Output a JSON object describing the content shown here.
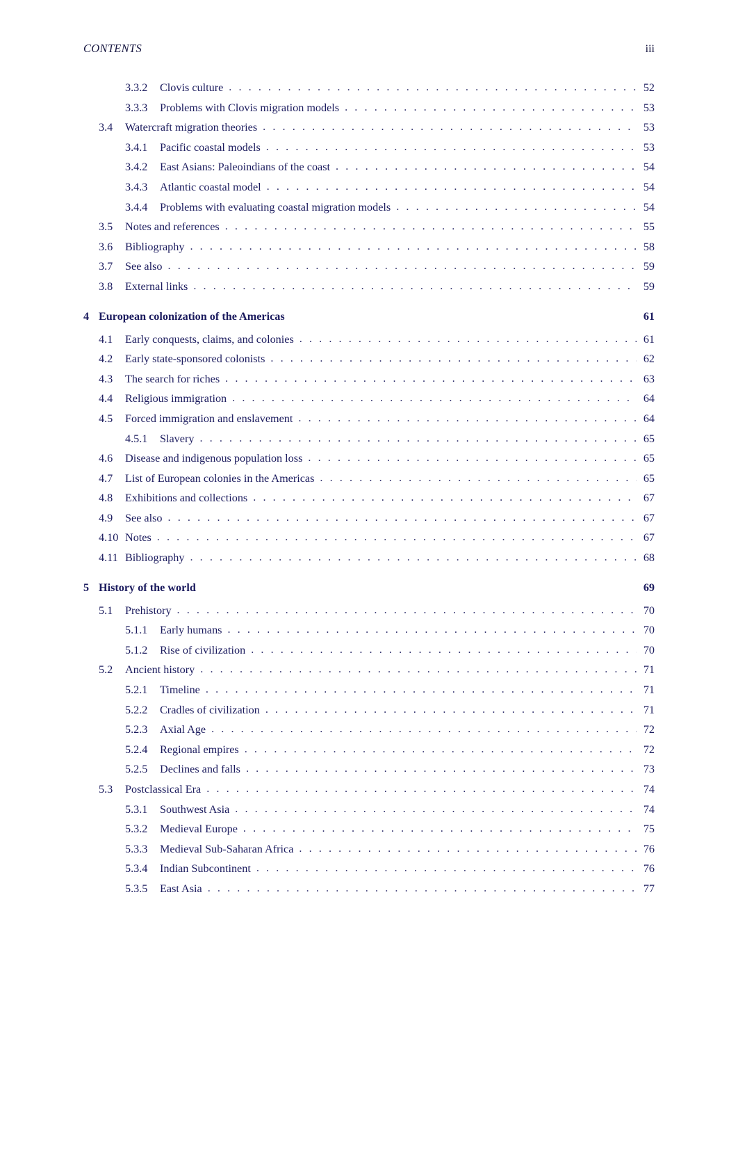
{
  "header": {
    "title": "CONTENTS",
    "folio": "iii"
  },
  "colors": {
    "text": "#1b1b5e",
    "page_background": "#ffffff"
  },
  "leader_dots": ". . . . . . . . . . . . . . . . . . . . . . . . . . . . . . . . . . . . . . . . . . . . . . . . . . . . . . . . . . . . . . . . . . . . . . . . . . . .",
  "toc": {
    "entries": [
      {
        "level": "lvl2",
        "number": "3.3.2",
        "title": "Clovis culture",
        "page": "52"
      },
      {
        "level": "lvl2",
        "number": "3.3.3",
        "title": "Problems with Clovis migration models",
        "page": "53"
      },
      {
        "level": "lvl1",
        "number": "3.4",
        "title": "Watercraft migration theories",
        "page": "53"
      },
      {
        "level": "lvl2",
        "number": "3.4.1",
        "title": "Pacific coastal models",
        "page": "53"
      },
      {
        "level": "lvl2",
        "number": "3.4.2",
        "title": "East Asians: Paleoindians of the coast",
        "page": "54"
      },
      {
        "level": "lvl2",
        "number": "3.4.3",
        "title": "Atlantic coastal model",
        "page": "54"
      },
      {
        "level": "lvl2",
        "number": "3.4.4",
        "title": "Problems with evaluating coastal migration models",
        "page": "54"
      },
      {
        "level": "lvl1",
        "number": "3.5",
        "title": "Notes and references",
        "page": "55"
      },
      {
        "level": "lvl1",
        "number": "3.6",
        "title": "Bibliography",
        "page": "58"
      },
      {
        "level": "lvl1",
        "number": "3.7",
        "title": "See also",
        "page": "59"
      },
      {
        "level": "lvl1",
        "number": "3.8",
        "title": "External links",
        "page": "59"
      },
      {
        "level": "chapter",
        "number": "4",
        "title": "European colonization of the Americas",
        "page": "61"
      },
      {
        "level": "lvl1",
        "number": "4.1",
        "title": "Early conquests, claims, and colonies",
        "page": "61"
      },
      {
        "level": "lvl1",
        "number": "4.2",
        "title": "Early state-sponsored colonists",
        "page": "62"
      },
      {
        "level": "lvl1",
        "number": "4.3",
        "title": "The search for riches",
        "page": "63"
      },
      {
        "level": "lvl1",
        "number": "4.4",
        "title": "Religious immigration",
        "page": "64"
      },
      {
        "level": "lvl1",
        "number": "4.5",
        "title": "Forced immigration and enslavement",
        "page": "64"
      },
      {
        "level": "lvl2",
        "number": "4.5.1",
        "title": "Slavery",
        "page": "65"
      },
      {
        "level": "lvl1",
        "number": "4.6",
        "title": "Disease and indigenous population loss",
        "page": "65"
      },
      {
        "level": "lvl1",
        "number": "4.7",
        "title": "List of European colonies in the Americas",
        "page": "65"
      },
      {
        "level": "lvl1",
        "number": "4.8",
        "title": "Exhibitions and collections",
        "page": "67"
      },
      {
        "level": "lvl1",
        "number": "4.9",
        "title": "See also",
        "page": "67"
      },
      {
        "level": "lvl1",
        "number": "4.10",
        "title": "Notes",
        "page": "67"
      },
      {
        "level": "lvl1",
        "number": "4.11",
        "title": "Bibliography",
        "page": "68"
      },
      {
        "level": "chapter",
        "number": "5",
        "title": "History of the world",
        "page": "69"
      },
      {
        "level": "lvl1",
        "number": "5.1",
        "title": "Prehistory",
        "page": "70"
      },
      {
        "level": "lvl2",
        "number": "5.1.1",
        "title": "Early humans",
        "page": "70"
      },
      {
        "level": "lvl2",
        "number": "5.1.2",
        "title": "Rise of civilization",
        "page": "70"
      },
      {
        "level": "lvl1",
        "number": "5.2",
        "title": "Ancient history",
        "page": "71"
      },
      {
        "level": "lvl2",
        "number": "5.2.1",
        "title": "Timeline",
        "page": "71"
      },
      {
        "level": "lvl2",
        "number": "5.2.2",
        "title": "Cradles of civilization",
        "page": "71"
      },
      {
        "level": "lvl2",
        "number": "5.2.3",
        "title": "Axial Age",
        "page": "72"
      },
      {
        "level": "lvl2",
        "number": "5.2.4",
        "title": "Regional empires",
        "page": "72"
      },
      {
        "level": "lvl2",
        "number": "5.2.5",
        "title": "Declines and falls",
        "page": "73"
      },
      {
        "level": "lvl1",
        "number": "5.3",
        "title": "Postclassical Era",
        "page": "74"
      },
      {
        "level": "lvl2",
        "number": "5.3.1",
        "title": "Southwest Asia",
        "page": "74"
      },
      {
        "level": "lvl2",
        "number": "5.3.2",
        "title": "Medieval Europe",
        "page": "75"
      },
      {
        "level": "lvl2",
        "number": "5.3.3",
        "title": "Medieval Sub-Saharan Africa",
        "page": "76"
      },
      {
        "level": "lvl2",
        "number": "5.3.4",
        "title": "Indian Subcontinent",
        "page": "76"
      },
      {
        "level": "lvl2",
        "number": "5.3.5",
        "title": "East Asia",
        "page": "77"
      }
    ]
  }
}
